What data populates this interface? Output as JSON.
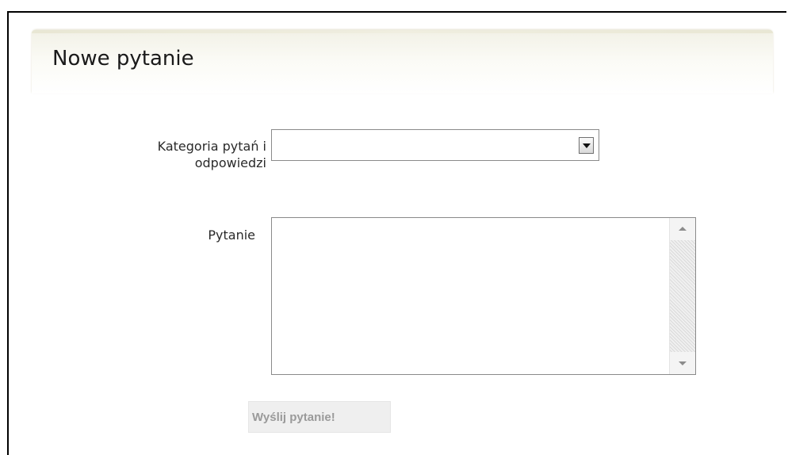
{
  "form": {
    "title": "Nowe pytanie",
    "category": {
      "label_line1": "Kategoria pytań i",
      "label_line2": "odpowiedzi",
      "selected_value": ""
    },
    "question": {
      "label": "Pytanie",
      "value": ""
    },
    "submit_label": "Wyślij pytanie!"
  },
  "icons": {
    "select_arrow": "chevron-down-icon",
    "scroll_up": "arrow-up-icon",
    "scroll_down": "arrow-down-icon"
  }
}
